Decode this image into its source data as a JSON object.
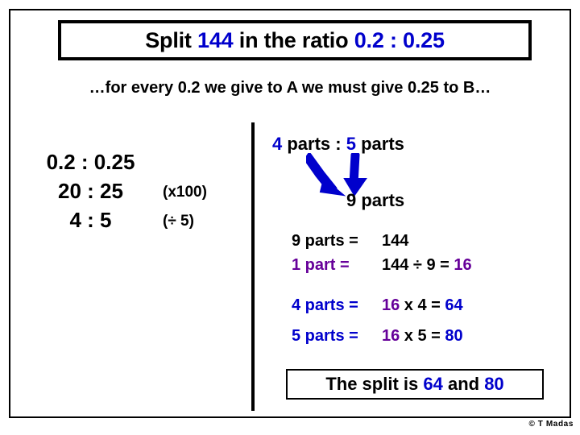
{
  "slide": {
    "title": {
      "prefix": "Split ",
      "number": "144",
      "middle": " in the ratio ",
      "ratio": "0.2 : 0.25"
    },
    "subtitle": "…for every 0.2 we give to A we must give 0.25 to B…",
    "left_column": {
      "rows": [
        {
          "value": "0.2 : 0.25",
          "operation": ""
        },
        {
          "value": "20 : 25",
          "operation": "(x100)"
        },
        {
          "value": "4 : 5",
          "operation": "(÷ 5)"
        }
      ]
    },
    "right_column": {
      "parts_line": {
        "a_count": "4",
        "a_word": " parts : ",
        "b_count": "5",
        "b_word": " parts"
      },
      "total_parts": "9 parts",
      "arrows_icon": "two-converging-arrows",
      "equations": [
        {
          "label": "9 parts = ",
          "label_color": "black",
          "body_pre": "144",
          "body_mid": "",
          "body_post": "",
          "result": "",
          "result_color": "black"
        },
        {
          "label": "1 part = ",
          "label_color": "purple",
          "body_pre": "144 ÷ 9 = ",
          "body_mid": "",
          "body_post": "",
          "result": "16",
          "result_color": "purple"
        },
        {
          "label": "4 parts = ",
          "label_color": "blue",
          "body_pre": "16",
          "body_mid": " x 4 = ",
          "body_post": "",
          "result": "64",
          "result_color": "blue"
        },
        {
          "label": "5 parts = ",
          "label_color": "blue",
          "body_pre": "16",
          "body_mid": " x 5 = ",
          "body_post": "",
          "result": "80",
          "result_color": "blue"
        }
      ]
    },
    "answer": {
      "prefix": "The split is ",
      "first": "64",
      "middle": " and ",
      "second": "80"
    },
    "footer": "© T Madas",
    "colors": {
      "blue": "#0000CC",
      "purple": "#660099",
      "black": "#000000"
    }
  }
}
